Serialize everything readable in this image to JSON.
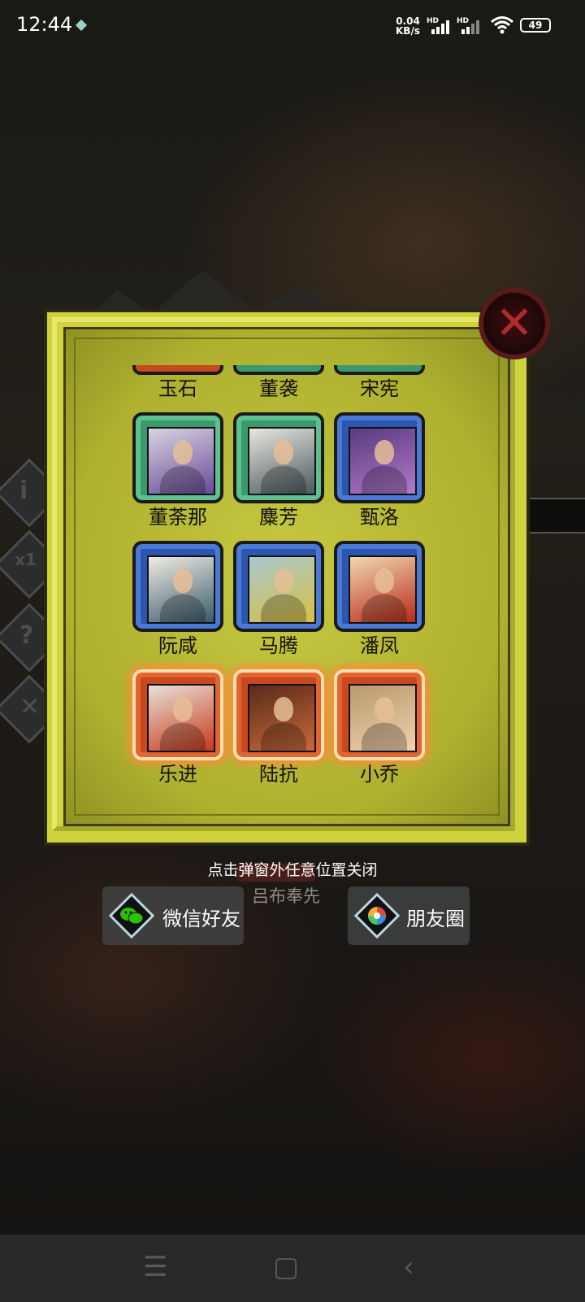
{
  "status_bar": {
    "time": "12:44",
    "net_speed_value": "0.04",
    "net_speed_unit": "KB/s",
    "signal_1_label": "HD",
    "signal_2_label": "HD",
    "battery": "49"
  },
  "background": {
    "hero_name": "吕布奉先"
  },
  "modal": {
    "top_row_partial": [
      "玉石",
      "董袭",
      "宋宪"
    ],
    "rows": [
      [
        {
          "name": "董荼那",
          "rarity": "green"
        },
        {
          "name": "麋芳",
          "rarity": "green"
        },
        {
          "name": "甄洛",
          "rarity": "blue"
        }
      ],
      [
        {
          "name": "阮咸",
          "rarity": "blue"
        },
        {
          "name": "马腾",
          "rarity": "blue"
        },
        {
          "name": "潘凤",
          "rarity": "blue"
        }
      ],
      [
        {
          "name": "乐进",
          "rarity": "orange"
        },
        {
          "name": "陆抗",
          "rarity": "orange"
        },
        {
          "name": "小乔",
          "rarity": "orange"
        }
      ]
    ],
    "close_icon": "close-icon"
  },
  "hint": "点击弹窗外任意位置关闭",
  "share": {
    "wechat_label": "微信好友",
    "moments_label": "朋友圈"
  },
  "colors": {
    "green": "#3a9a6e",
    "blue": "#2c56b0",
    "orange": "#c84820",
    "panel": "#cfd23c"
  }
}
